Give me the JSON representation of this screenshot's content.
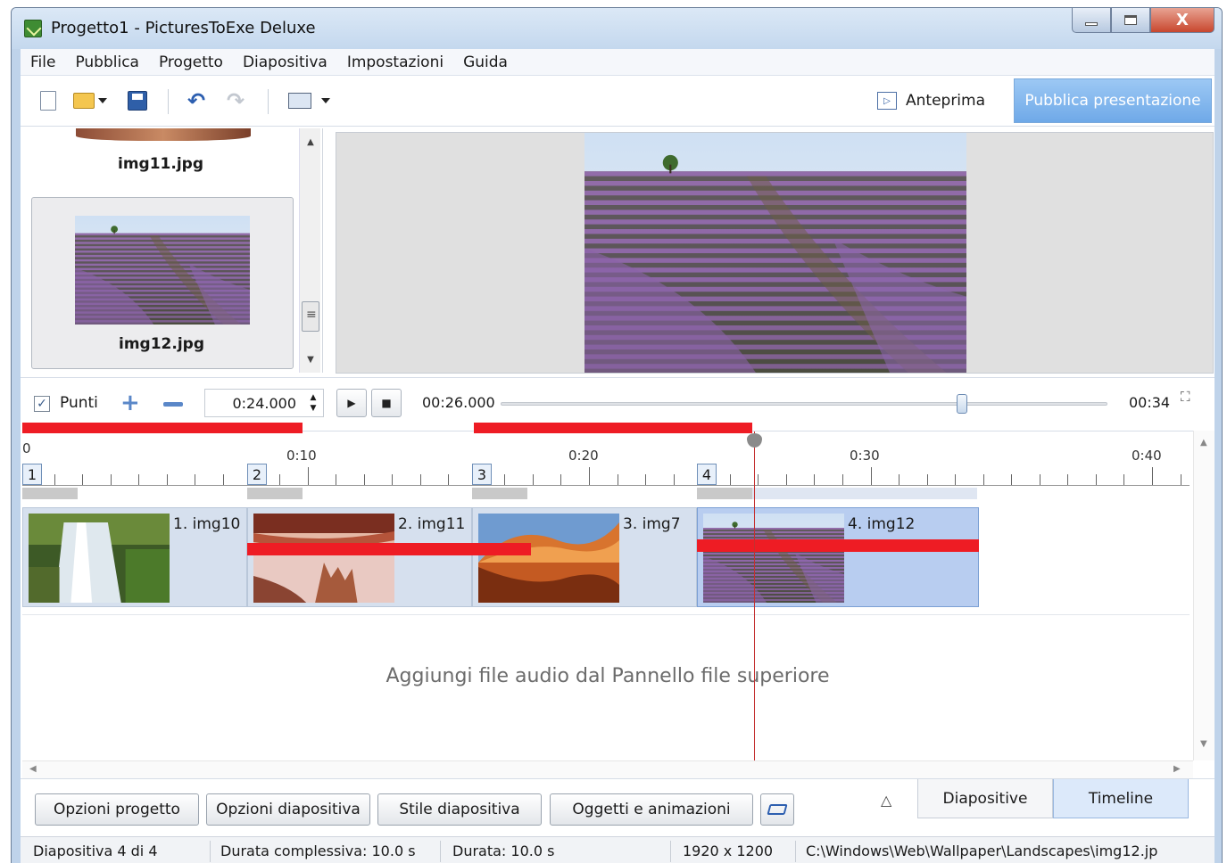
{
  "window": {
    "title": "Progetto1 - PicturesToExe Deluxe",
    "close_glyph": "X"
  },
  "menu": [
    "File",
    "Pubblica",
    "Progetto",
    "Diapositiva",
    "Impostazioni",
    "Guida"
  ],
  "toolbar": {
    "undo_glyph": "↶",
    "redo_glyph": "↷",
    "preview_label": "Anteprima",
    "preview_glyph": "▷",
    "publish_label": "Pubblica presentazione"
  },
  "files": {
    "items": [
      {
        "name": "img11.jpg"
      },
      {
        "name": "img12.jpg",
        "selected": true
      }
    ]
  },
  "controls": {
    "points_label": "Punti",
    "points_checked": true,
    "check_glyph": "✓",
    "plus_glyph": "+",
    "time_value": "0:24.000",
    "spin_up_glyph": "▲",
    "spin_down_glyph": "▼",
    "play_glyph": "▶",
    "stop_glyph": "■",
    "current_time": "00:26.000",
    "end_time": "00:34",
    "position_fraction": 0.76,
    "fullscreen_glyph": "⛶"
  },
  "timeline": {
    "ruler_labels": [
      "0",
      "0:10",
      "0:20",
      "0:30",
      "0:40"
    ],
    "slides": [
      {
        "num": "1",
        "name": "1. img10"
      },
      {
        "num": "2",
        "name": "2. img11"
      },
      {
        "num": "3",
        "name": "3. img7"
      },
      {
        "num": "4",
        "name": "4. img12",
        "selected": true
      }
    ],
    "audio_hint": "Aggiungi file audio dal Pannello file superiore",
    "scroll_up_glyph": "▲",
    "scroll_down_glyph": "▼",
    "scroll_left_glyph": "◀",
    "scroll_right_glyph": "▶"
  },
  "bottom": {
    "buttons": [
      "Opzioni progetto",
      "Opzioni diapositiva",
      "Stile diapositiva",
      "Oggetti e animazioni"
    ],
    "collapse_glyph": "△",
    "tabs": {
      "slides": "Diapositive",
      "timeline": "Timeline",
      "active": "Timeline"
    }
  },
  "status": {
    "slide": "Diapositiva 4 di 4",
    "total": "Durata complessiva: 10.0 s",
    "duration": "Durata: 10.0 s",
    "resolution": "1920 x 1200",
    "path": "C:\\Windows\\Web\\Wallpaper\\Landscapes\\img12.jp"
  },
  "colors": {
    "accent": "#ee1c24",
    "publish": "#6fa9e8",
    "selection": "#b8cdf0"
  }
}
